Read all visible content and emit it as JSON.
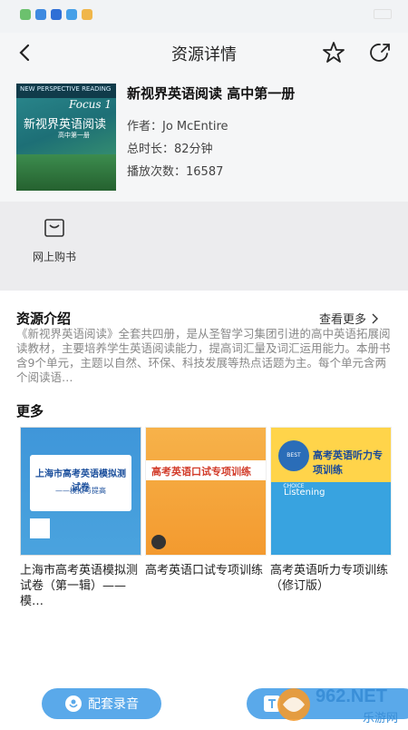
{
  "header": {
    "title": "资源详情"
  },
  "resource": {
    "title": "新视界英语阅读 高中第一册",
    "author_label": "作者：",
    "author": "Jo McEntire",
    "duration_label": "总时长：",
    "duration": "82分钟",
    "plays_label": "播放次数：",
    "plays": "16587",
    "cover": {
      "en_line": "NEW PERSPECTIVE READING",
      "focus": "Focus 1",
      "cn_title": "新视界英语阅读",
      "cn_sub": "高中第一册"
    }
  },
  "shop": {
    "label": "网上购书"
  },
  "intro": {
    "title": "资源介绍",
    "more": "查看更多",
    "text": "《新视界英语阅读》全套共四册，是从圣智学习集团引进的高中英语拓展阅读教材，主要培养学生英语阅读能力，提高词汇量及词汇运用能力。本册书含9个单元，主题以自然、环保、科技发展等热点话题为主。每个单元含两个阅读语…"
  },
  "more": {
    "title": "更多",
    "items": [
      {
        "title": "上海市高考英语模拟测试卷（第一辑）——模…",
        "cover_text": "上海市高考英语模拟测试卷",
        "cover_sub": "——模拟与提高"
      },
      {
        "title": "高考英语口试专项训练",
        "cover_text": "高考英语口试专项训练"
      },
      {
        "title": "高考英语听力专项训练（修订版）",
        "cover_text": "高考英语听力专项训练",
        "cover_badge": "BEST CHOICE",
        "cover_en": "Listening"
      }
    ]
  },
  "bottom": {
    "audio_label": "配套录音"
  },
  "watermark": {
    "text": "962.NET",
    "sub": "乐游网"
  },
  "colors": {
    "accent": "#5aa9ea",
    "panel": "#f5f6f7"
  }
}
